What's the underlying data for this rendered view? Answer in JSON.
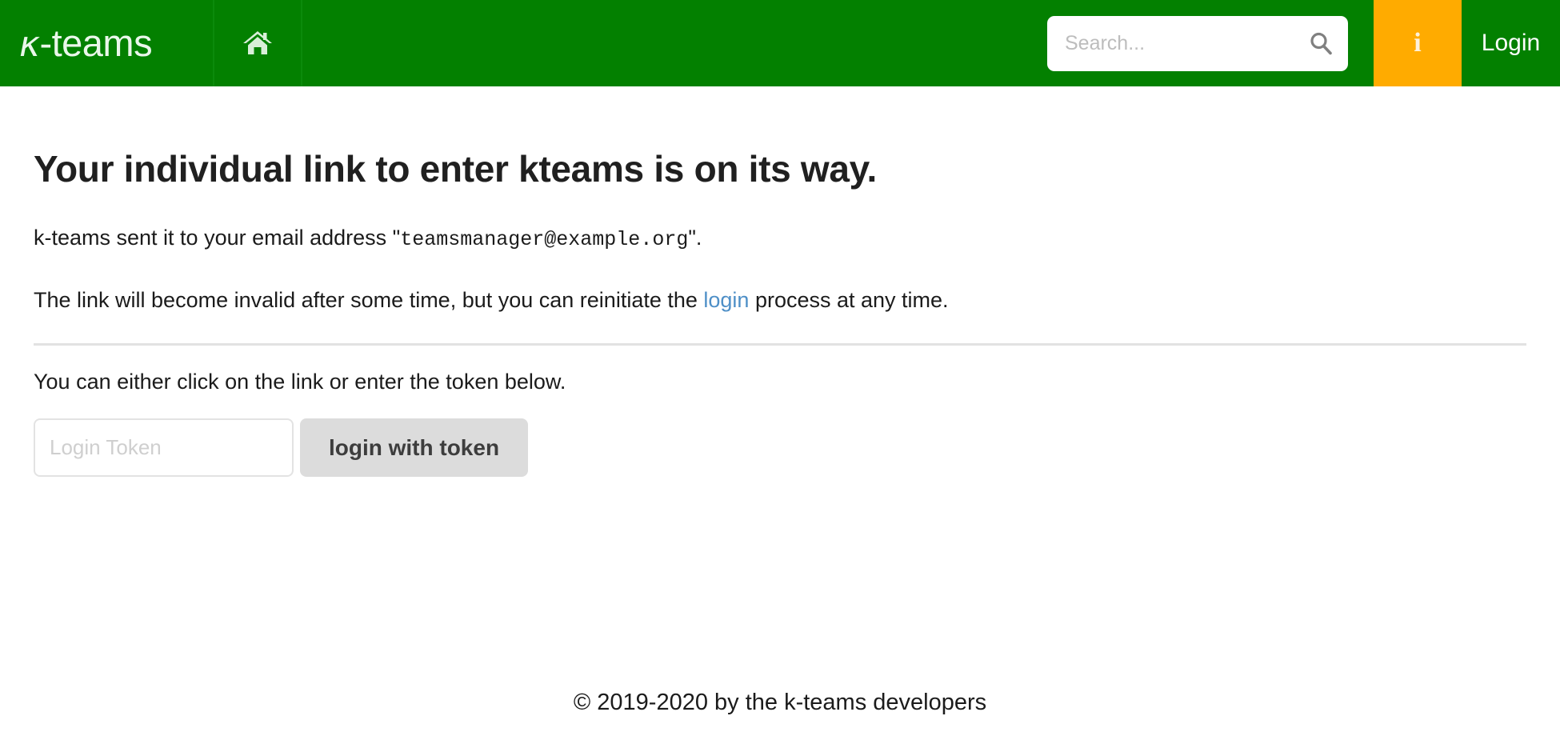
{
  "navbar": {
    "brand_kappa": "κ",
    "brand_rest": "-teams",
    "home_icon": "home-icon",
    "search": {
      "placeholder": "Search...",
      "value": "",
      "icon": "search-icon"
    },
    "info_label": "i",
    "login_label": "Login",
    "colors": {
      "green": "#038000",
      "orange": "#ffab00",
      "brand_text": "#eaf7ea"
    }
  },
  "main": {
    "title": "Your individual link to enter kteams is on its way.",
    "sent_prefix": "k-teams sent it to your email address \"",
    "email": "teamsmanager@example.org",
    "sent_suffix": "\".",
    "invalid_prefix": "The link will become invalid after some time, but you can reinitiate the ",
    "login_link": "login",
    "invalid_suffix": " process at any time.",
    "token_hint": "You can either click on the link or enter the token below.",
    "token_placeholder": "Login Token",
    "token_value": "",
    "token_button": "login with token",
    "link_color": "#4e8fc7"
  },
  "footer": {
    "copyright": "© 2019-2020 by the k-teams developers"
  }
}
